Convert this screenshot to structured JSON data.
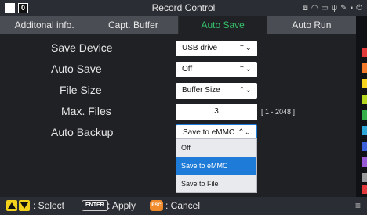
{
  "window": {
    "title": "Record Control",
    "badge": "0",
    "status_icons": [
      "network-icon",
      "wifi-icon",
      "storage-icon",
      "usb-icon",
      "tools-icon",
      "sd-card-icon",
      "power-plug-icon"
    ]
  },
  "tabs": [
    {
      "label": "Additonal info.",
      "active": false
    },
    {
      "label": "Capt. Buffer",
      "active": false
    },
    {
      "label": "Auto Save",
      "active": true
    },
    {
      "label": "Auto Run",
      "active": false
    }
  ],
  "settings": {
    "save_device": {
      "label": "Save Device",
      "value": "USB drive"
    },
    "auto_save": {
      "label": "Auto Save",
      "value": "Off"
    },
    "file_size": {
      "label": "File Size",
      "value": "Buffer Size"
    },
    "max_files": {
      "label": "Max. Files",
      "value": "3",
      "range": "[ 1 - 2048 ]"
    },
    "auto_backup": {
      "label": "Auto Backup",
      "value": "Save to eMMC",
      "options": [
        "Off",
        "Save to eMMC",
        "Save to File"
      ],
      "selected_index": 1
    }
  },
  "channel_colors": [
    "#e23a3a",
    "#f07a2a",
    "#f5d21b",
    "#b5d61e",
    "#33b04a",
    "#2fa6d8",
    "#3b5fd8",
    "#9a5ad8",
    "#9a9a9a",
    "#e23a3a"
  ],
  "colors": {
    "active_tab_text": "#35c06a",
    "selected_option": "#1e7bd8",
    "esc_key": "#f08a2b",
    "nav_keys": "#f3d21b"
  },
  "footer": {
    "select_text": ": Select",
    "enter_key": "ENTER",
    "apply_text": ": Apply",
    "esc_key": "ESC",
    "cancel_text": ": Cancel"
  }
}
